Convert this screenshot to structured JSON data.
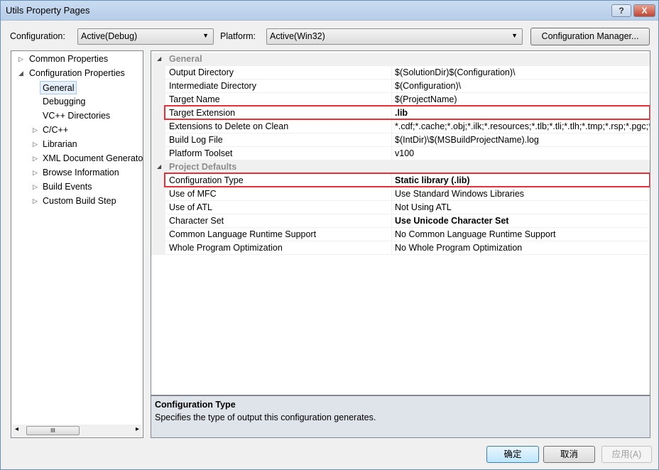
{
  "window": {
    "title": "Utils Property Pages",
    "help_label": "?",
    "close_label": "X"
  },
  "toolbar": {
    "configuration_label": "Configuration:",
    "configuration_value": "Active(Debug)",
    "platform_label": "Platform:",
    "platform_value": "Active(Win32)",
    "config_manager_label": "Configuration Manager..."
  },
  "tree": {
    "items": [
      {
        "label": "Common Properties",
        "expander": "▷"
      },
      {
        "label": "Configuration Properties",
        "expander": "◢"
      },
      {
        "label": "General",
        "expander": ""
      },
      {
        "label": "Debugging",
        "expander": ""
      },
      {
        "label": "VC++ Directories",
        "expander": ""
      },
      {
        "label": "C/C++",
        "expander": "▷"
      },
      {
        "label": "Librarian",
        "expander": "▷"
      },
      {
        "label": "XML Document Generator",
        "expander": "▷"
      },
      {
        "label": "Browse Information",
        "expander": "▷"
      },
      {
        "label": "Build Events",
        "expander": "▷"
      },
      {
        "label": "Custom Build Step",
        "expander": "▷"
      }
    ],
    "scroll_thumb": "III",
    "scroll_left": "◂",
    "scroll_right": "▸"
  },
  "grid": {
    "general": {
      "title": "General",
      "rows": [
        {
          "name": "Output Directory",
          "value": "$(SolutionDir)$(Configuration)\\"
        },
        {
          "name": "Intermediate Directory",
          "value": "$(Configuration)\\"
        },
        {
          "name": "Target Name",
          "value": "$(ProjectName)"
        },
        {
          "name": "Target Extension",
          "value": ".lib"
        },
        {
          "name": "Extensions to Delete on Clean",
          "value": "*.cdf;*.cache;*.obj;*.ilk;*.resources;*.tlb;*.tli;*.tlh;*.tmp;*.rsp;*.pgc;*.pgd;*.meta"
        },
        {
          "name": "Build Log File",
          "value": "$(IntDir)\\$(MSBuildProjectName).log"
        },
        {
          "name": "Platform Toolset",
          "value": "v100"
        }
      ]
    },
    "defaults": {
      "title": "Project Defaults",
      "rows": [
        {
          "name": "Configuration Type",
          "value": "Static library (.lib)"
        },
        {
          "name": "Use of MFC",
          "value": "Use Standard Windows Libraries"
        },
        {
          "name": "Use of ATL",
          "value": "Not Using ATL"
        },
        {
          "name": "Character Set",
          "value": "Use Unicode Character Set"
        },
        {
          "name": "Common Language Runtime Support",
          "value": "No Common Language Runtime Support"
        },
        {
          "name": "Whole Program Optimization",
          "value": "No Whole Program Optimization"
        }
      ]
    }
  },
  "description": {
    "title": "Configuration Type",
    "text": "Specifies the type of output this configuration generates."
  },
  "buttons": {
    "ok": "确定",
    "cancel": "取消",
    "apply": "应用(A)"
  },
  "colors": {
    "highlight": "#e8303a"
  }
}
